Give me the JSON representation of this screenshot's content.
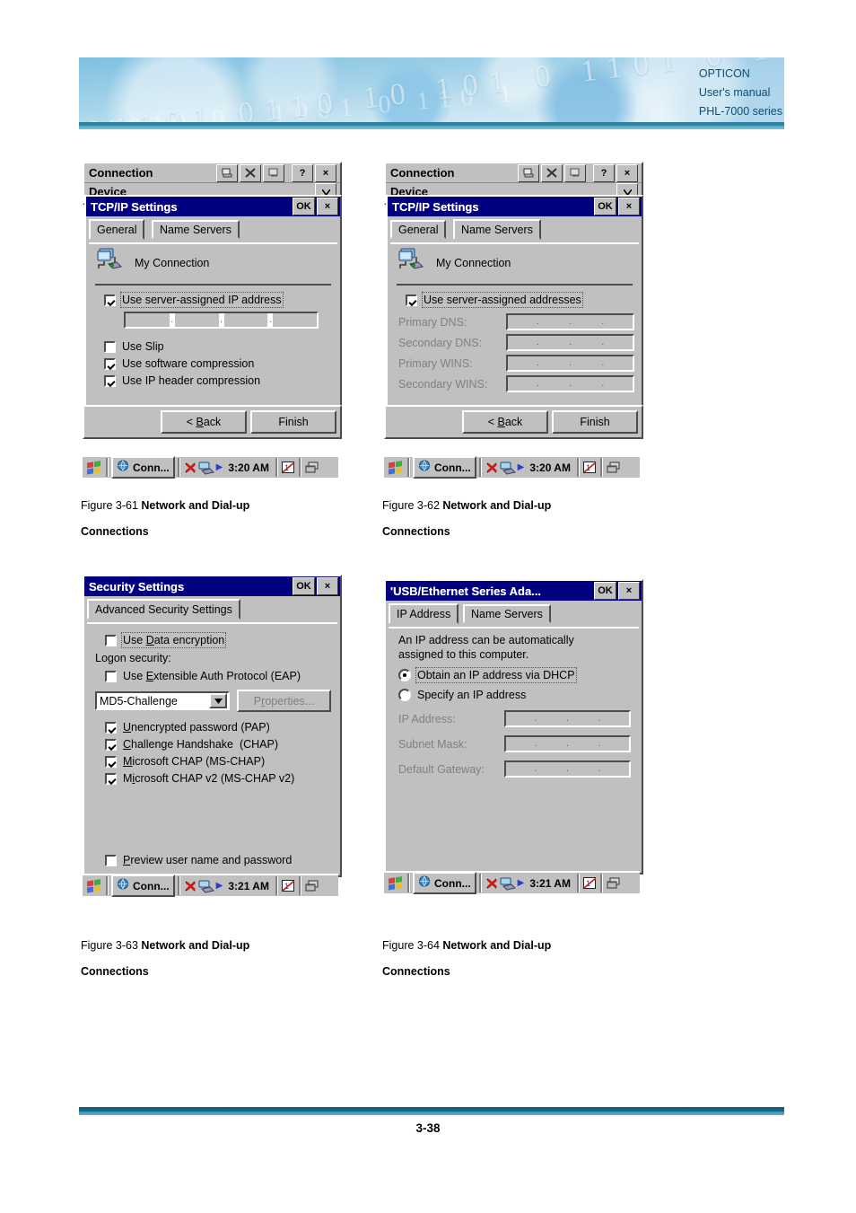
{
  "header": {
    "brand": "OPTICON",
    "line2": "User's manual",
    "line3": "PHL-7000 series"
  },
  "footer": {
    "page_number": "3-38"
  },
  "background_window": {
    "title": "Connection",
    "help_btn": "?",
    "close_btn": "×",
    "device_label": "Device"
  },
  "figures": [
    {
      "id": "fig-3-61",
      "caption_prefix": "Figure 3-61 ",
      "caption_bold": "Network and Dial-up",
      "caption_line2": "Connections",
      "window": {
        "title": "TCP/IP Settings",
        "ok_label": "OK",
        "close_label": "×",
        "tabs": [
          {
            "label": "General",
            "selected": true
          },
          {
            "label": "Name Servers",
            "selected": false
          }
        ],
        "connection_name": "My Connection",
        "checkboxes": [
          {
            "label": "Use server-assigned IP address",
            "checked": true,
            "focused": true
          },
          {
            "label": "Use Slip",
            "checked": false,
            "focused": false
          },
          {
            "label": "Use software compression",
            "checked": true,
            "focused": false
          },
          {
            "label": "Use IP header compression",
            "checked": true,
            "focused": false
          }
        ],
        "ip_value": "",
        "buttons": [
          {
            "label": "< Back",
            "accel": "B"
          },
          {
            "label": "Finish",
            "accel": ""
          }
        ]
      },
      "taskbar": {
        "task_label": "Conn...",
        "time": "3:20 AM"
      }
    },
    {
      "id": "fig-3-62",
      "caption_prefix": "Figure 3-62 ",
      "caption_bold": "Network and Dial-up",
      "caption_line2": "Connections",
      "window": {
        "title": "TCP/IP Settings",
        "ok_label": "OK",
        "close_label": "×",
        "tabs": [
          {
            "label": "General",
            "selected": false
          },
          {
            "label": "Name Servers",
            "selected": true
          }
        ],
        "connection_name": "My Connection",
        "checkbox": {
          "label": "Use server-assigned addresses",
          "checked": true,
          "focused": true
        },
        "fields": [
          {
            "label": "Primary DNS:",
            "value": "",
            "disabled": true
          },
          {
            "label": "Secondary DNS:",
            "value": "",
            "disabled": true
          },
          {
            "label": "Primary WINS:",
            "value": "",
            "disabled": true
          },
          {
            "label": "Secondary WINS:",
            "value": "",
            "disabled": true
          }
        ],
        "buttons": [
          {
            "label": "< Back",
            "accel": "B"
          },
          {
            "label": "Finish",
            "accel": ""
          }
        ]
      },
      "taskbar": {
        "task_label": "Conn...",
        "time": "3:20 AM"
      }
    },
    {
      "id": "fig-3-63",
      "caption_prefix": "Figure 3-63 ",
      "caption_bold": "Network and Dial-up",
      "caption_line2": "Connections",
      "window": {
        "title": "Security Settings",
        "ok_label": "OK",
        "close_label": "×",
        "tabs": [
          {
            "label": "Advanced Security Settings",
            "selected": true
          }
        ],
        "data_encryption": {
          "label": "Use Data encryption",
          "checked": false,
          "focused": true
        },
        "logon_security_label": "Logon security:",
        "eap": {
          "label": "Use Extensible Auth Protocol (EAP)",
          "checked": false
        },
        "eap_select_value": "MD5-Challenge",
        "properties_button": "Properties...",
        "auth_methods": [
          {
            "label": "Unencrypted password (PAP)",
            "checked": true
          },
          {
            "label": "Challenge Handshake  (CHAP)",
            "checked": true
          },
          {
            "label": "Microsoft CHAP (MS-CHAP)",
            "checked": true
          },
          {
            "label": "Microsoft CHAP v2 (MS-CHAP v2)",
            "checked": true
          }
        ],
        "preview": {
          "label": "Preview user name and password",
          "checked": false
        }
      },
      "taskbar": {
        "task_label": "Conn...",
        "time": "3:21 AM"
      }
    },
    {
      "id": "fig-3-64",
      "caption_prefix": "Figure 3-64 ",
      "caption_bold": "Network and Dial-up",
      "caption_line2": "Connections",
      "window": {
        "title": "'USB/Ethernet Series Ada...",
        "ok_label": "OK",
        "close_label": "×",
        "tabs": [
          {
            "label": "IP Address",
            "selected": true
          },
          {
            "label": "Name Servers",
            "selected": false
          }
        ],
        "description_line1": "An IP address can be automatically",
        "description_line2": "assigned to this computer.",
        "radios": [
          {
            "label": "Obtain an IP address via DHCP",
            "selected": true,
            "focused": true
          },
          {
            "label": "Specify an IP address",
            "selected": false,
            "focused": false
          }
        ],
        "fields": [
          {
            "label": "IP Address:",
            "value": "",
            "disabled": true
          },
          {
            "label": "Subnet Mask:",
            "value": "",
            "disabled": true
          },
          {
            "label": "Default Gateway:",
            "value": "",
            "disabled": true
          }
        ]
      },
      "taskbar": {
        "task_label": "Conn...",
        "time": "3:21 AM"
      }
    }
  ],
  "colors": {
    "titlebar": "#000080",
    "dialog_face": "#c0c0c0",
    "banner_blue": "#2c7f9e",
    "footer_blue": "#0d5f7e",
    "disabled_text": "#808080"
  }
}
